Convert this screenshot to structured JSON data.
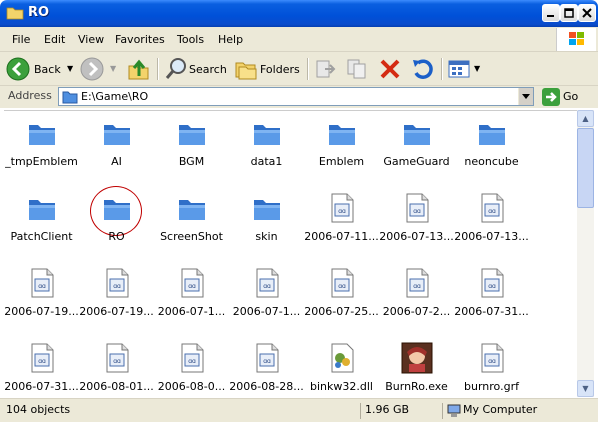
{
  "window": {
    "title": "RO"
  },
  "menu": {
    "items": [
      "File",
      "Edit",
      "View",
      "Favorites",
      "Tools",
      "Help"
    ]
  },
  "toolbar": {
    "back_label": "Back",
    "search_label": "Search",
    "folders_label": "Folders"
  },
  "address": {
    "label": "Address",
    "value": "E:\\Game\\RO",
    "go_label": "Go"
  },
  "files": [
    {
      "name": "_tmpEmblem",
      "icon": "folder-icon"
    },
    {
      "name": "AI",
      "icon": "folder-icon"
    },
    {
      "name": "BGM",
      "icon": "folder-icon"
    },
    {
      "name": "data1",
      "icon": "folder-icon"
    },
    {
      "name": "Emblem",
      "icon": "folder-icon"
    },
    {
      "name": "GameGuard",
      "icon": "folder-icon"
    },
    {
      "name": "neoncube",
      "icon": "folder-icon"
    },
    {
      "name": "PatchClient",
      "icon": "folder-icon"
    },
    {
      "name": "RO",
      "icon": "folder-icon",
      "highlighted": true
    },
    {
      "name": "ScreenShot",
      "icon": "folder-icon"
    },
    {
      "name": "skin",
      "icon": "folder-icon"
    },
    {
      "name": "2006-07-11...",
      "icon": "image-file-icon"
    },
    {
      "name": "2006-07-13...",
      "icon": "image-file-icon"
    },
    {
      "name": "2006-07-13...",
      "icon": "image-file-icon"
    },
    {
      "name": "2006-07-19...",
      "icon": "image-file-icon"
    },
    {
      "name": "2006-07-19...",
      "icon": "image-file-icon"
    },
    {
      "name": "2006-07-1...",
      "icon": "image-file-icon"
    },
    {
      "name": "2006-07-1...",
      "icon": "image-file-icon"
    },
    {
      "name": "2006-07-25...",
      "icon": "image-file-icon"
    },
    {
      "name": "2006-07-2...",
      "icon": "image-file-icon"
    },
    {
      "name": "2006-07-31...",
      "icon": "image-file-icon"
    },
    {
      "name": "2006-07-31...",
      "icon": "image-file-icon"
    },
    {
      "name": "2006-08-01...",
      "icon": "image-file-icon"
    },
    {
      "name": "2006-08-0...",
      "icon": "image-file-icon"
    },
    {
      "name": "2006-08-28...",
      "icon": "image-file-icon"
    },
    {
      "name": "binkw32.dll",
      "icon": "dll-file-icon"
    },
    {
      "name": "BurnRo.exe",
      "icon": "exe-file-icon"
    },
    {
      "name": "burnro.grf",
      "icon": "image-file-icon"
    }
  ],
  "status": {
    "objects": "104 objects",
    "size": "1.96 GB",
    "location": "My Computer"
  },
  "colors": {
    "titlebar": "#0050d8",
    "chrome": "#ece9d8",
    "highlight_circle": "#c00000",
    "folder": "#4f8fe0"
  }
}
